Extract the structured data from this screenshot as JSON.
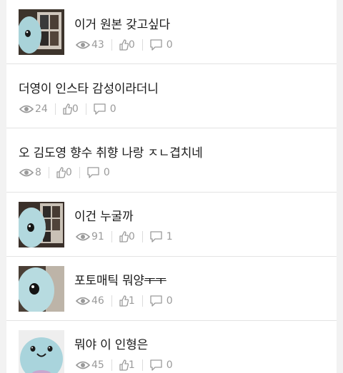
{
  "posts": [
    {
      "title": "이거 원본 갖고싶다",
      "views": "43",
      "likes": "0",
      "comments": "0",
      "has_thumb": true,
      "thumb": "plush-photo-icon"
    },
    {
      "title": "더영이 인스타 감성이라더니",
      "views": "24",
      "likes": "0",
      "comments": "0",
      "has_thumb": false
    },
    {
      "title": "오 김도영 향수 취향 나랑 ㅈㄴ겹치네",
      "views": "8",
      "likes": "0",
      "comments": "0",
      "has_thumb": false
    },
    {
      "title": "이건 누굴까",
      "views": "91",
      "likes": "0",
      "comments": "1",
      "has_thumb": true,
      "thumb": "plush-photo-icon"
    },
    {
      "title_main": "포토매틱 뭐양",
      "title_strike": "ㅜㅜ",
      "views": "46",
      "likes": "1",
      "comments": "0",
      "has_thumb": true,
      "thumb": "plush-photo-icon"
    },
    {
      "title": "뭐야 이 인형은",
      "views": "45",
      "likes": "1",
      "comments": "0",
      "has_thumb": true,
      "thumb": "plush-smile-icon"
    }
  ],
  "colors": {
    "background": "#f2f2f2",
    "card": "#ffffff",
    "text": "#1a1a1a",
    "meta": "#9a9a9a",
    "divider": "#e3e3e3"
  },
  "icons": [
    "eye-icon",
    "thumbs-up-icon",
    "comment-icon"
  ]
}
